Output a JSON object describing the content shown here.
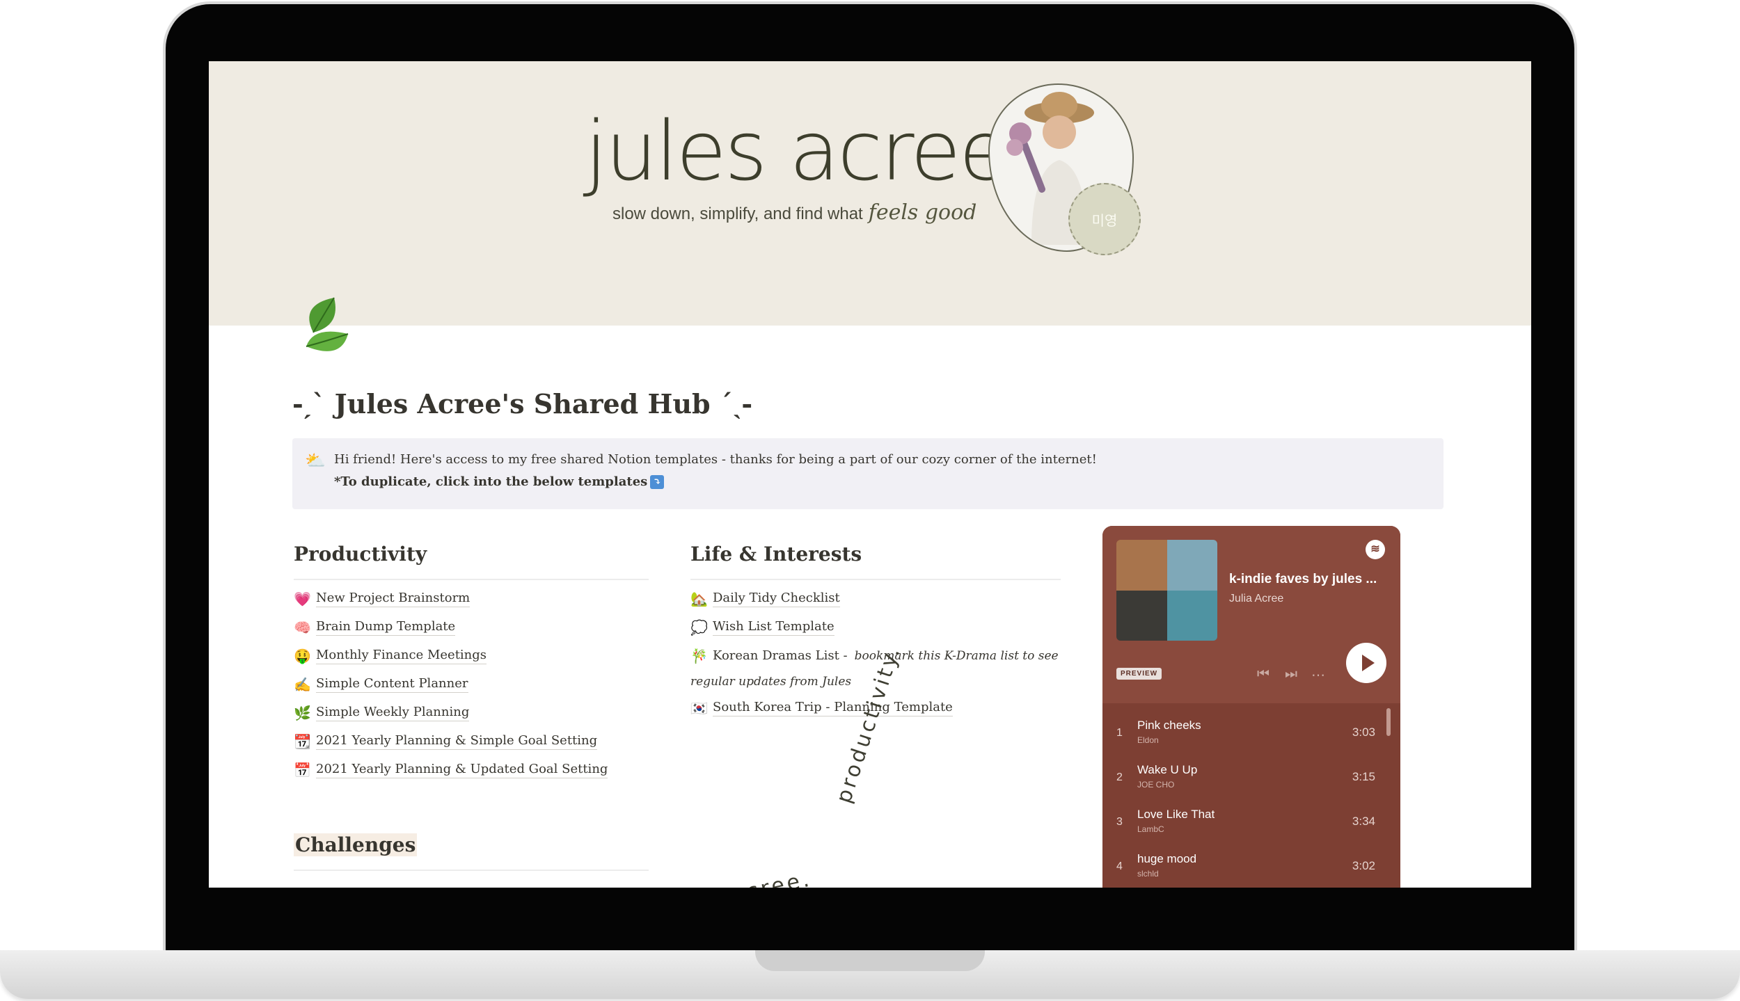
{
  "brand": {
    "name": "jules acree",
    "tagline": "slow down, simplify, and find what",
    "tagline_script": "feels good",
    "sticker_text": "미영"
  },
  "page": {
    "title": "-ˏˋ Jules Acree's Shared Hub ˊˎ-"
  },
  "callout": {
    "icon": "⛅",
    "line1": "Hi friend! Here's access to my free shared Notion templates - thanks for being a part of our cozy corner of the internet!",
    "line2": "*To duplicate, click into the below templates",
    "line2_icon": "⤵"
  },
  "productivity": {
    "heading": "Productivity",
    "items": [
      {
        "icon": "💗",
        "label": "New Project Brainstorm"
      },
      {
        "icon": "🧠",
        "label": "Brain Dump Template"
      },
      {
        "icon": "🤑",
        "label": "Monthly Finance Meetings"
      },
      {
        "icon": "✍",
        "label": "Simple Content Planner"
      },
      {
        "icon": "🌿",
        "label": "Simple Weekly Planning"
      },
      {
        "icon": "📆",
        "label": "2021 Yearly Planning & Simple Goal Setting"
      },
      {
        "icon": "📅",
        "label": "2021 Yearly Planning & Updated Goal Setting"
      }
    ]
  },
  "challenges": {
    "heading": "Challenges"
  },
  "life": {
    "heading": "Life & Interests",
    "items": [
      {
        "icon": "🏡",
        "label": "Daily Tidy Checklist"
      },
      {
        "icon": "💭",
        "label": "Wish List Template"
      },
      {
        "icon": "🎋",
        "label": "Korean Dramas List - ",
        "note": "bookmark this K-Drama list to see"
      },
      {
        "icon": "",
        "label": "",
        "note": "regular updates from Jules"
      },
      {
        "icon": "🇰🇷",
        "label": "South Korea Trip - Planning Template"
      }
    ]
  },
  "decor": {
    "arc1": "productivity.",
    "arc2": "acree."
  },
  "player": {
    "playlist_title": "k-indie faves by jules ...",
    "owner": "Julia Acree",
    "preview_label": "PREVIEW",
    "tracks": [
      {
        "num": "1",
        "name": "Pink cheeks",
        "artist": "Eldon",
        "duration": "3:03"
      },
      {
        "num": "2",
        "name": "Wake U Up",
        "artist": "JOE CHO",
        "duration": "3:15"
      },
      {
        "num": "3",
        "name": "Love Like That",
        "artist": "LambC",
        "duration": "3:34"
      },
      {
        "num": "4",
        "name": "huge mood",
        "artist": "slchld",
        "duration": "3:02"
      }
    ]
  }
}
